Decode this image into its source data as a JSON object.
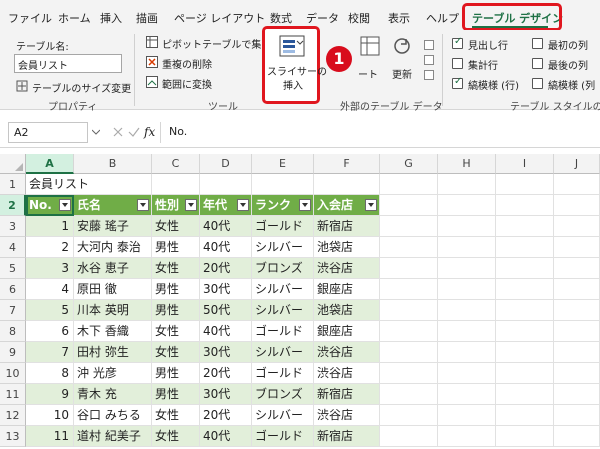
{
  "ribbon_tabs": [
    "ファイル",
    "ホーム",
    "挿入",
    "描画",
    "ページ レイアウト",
    "数式",
    "データ",
    "校閲",
    "表示",
    "ヘルプ",
    "テーブル デザイン"
  ],
  "ribbon": {
    "table_name_label": "テーブル名:",
    "table_name_value": "会員リスト",
    "resize_table": "テーブルのサイズ変更",
    "group_properties": "プロパティ",
    "pivot": "ピボットテーブルで集計",
    "remove_duplicates": "重複の削除",
    "convert_range": "範囲に変換",
    "group_tools": "ツール",
    "slicer_line1": "スライサーの",
    "slicer_line2": "挿入",
    "badge": "1",
    "export_partial": "ート",
    "refresh": "更新",
    "group_external": "外部のテーブル データ",
    "opt_header_row": "見出し行",
    "opt_total_row": "集計行",
    "opt_banded_rows": "縞模様 (行)",
    "opt_first_col": "最初の列",
    "opt_last_col": "最後の列",
    "opt_banded_cols": "縞模様 (列",
    "group_style_options": "テーブル スタイルのオ"
  },
  "formula_bar": {
    "cell_ref": "A2",
    "fx": "fx",
    "value": "No."
  },
  "grid": {
    "columns": [
      "A",
      "B",
      "C",
      "D",
      "E",
      "F",
      "G",
      "H",
      "I",
      "J"
    ],
    "title": "会員リスト",
    "headers": [
      "No.",
      "氏名",
      "性別",
      "年代",
      "ランク",
      "入会店"
    ],
    "rows": [
      [
        "1",
        "安藤 瑤子",
        "女性",
        "40代",
        "ゴールド",
        "新宿店"
      ],
      [
        "2",
        "大河内 泰治",
        "男性",
        "40代",
        "シルバー",
        "池袋店"
      ],
      [
        "3",
        "水谷 恵子",
        "女性",
        "20代",
        "ブロンズ",
        "渋谷店"
      ],
      [
        "4",
        "原田 徹",
        "男性",
        "30代",
        "シルバー",
        "銀座店"
      ],
      [
        "5",
        "川本 英明",
        "男性",
        "50代",
        "シルバー",
        "池袋店"
      ],
      [
        "6",
        "木下 香織",
        "女性",
        "40代",
        "ゴールド",
        "銀座店"
      ],
      [
        "7",
        "田村 弥生",
        "女性",
        "30代",
        "シルバー",
        "渋谷店"
      ],
      [
        "8",
        "沖 光彦",
        "男性",
        "20代",
        "ゴールド",
        "渋谷店"
      ],
      [
        "9",
        "青木 充",
        "男性",
        "30代",
        "ブロンズ",
        "新宿店"
      ],
      [
        "10",
        "谷口 みちる",
        "女性",
        "20代",
        "シルバー",
        "渋谷店"
      ],
      [
        "11",
        "道村 紀美子",
        "女性",
        "40代",
        "ゴールド",
        "新宿店"
      ]
    ],
    "row_numbers": [
      "1",
      "2",
      "3",
      "4",
      "5",
      "6",
      "7",
      "8",
      "9",
      "10",
      "11",
      "12",
      "13"
    ]
  },
  "colors": {
    "accent": "#1e7145",
    "header_green": "#70ad47",
    "band_green": "#e2efda",
    "highlight_red": "#e0161e"
  }
}
